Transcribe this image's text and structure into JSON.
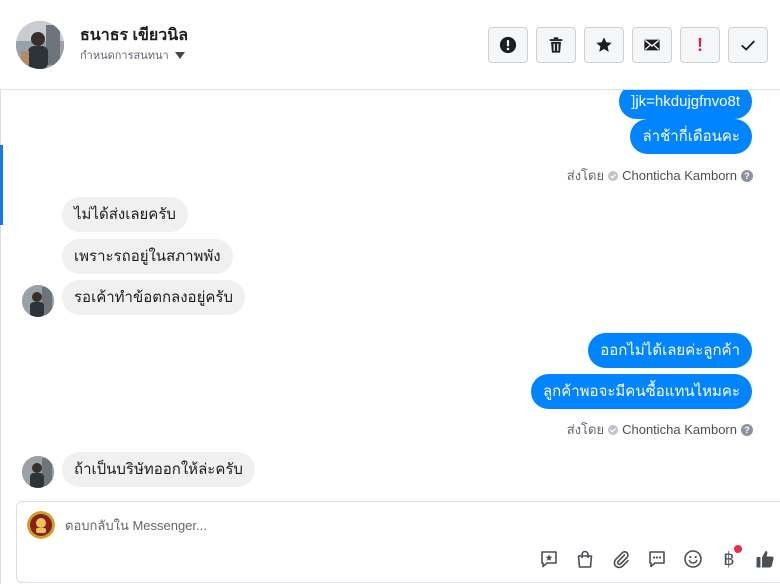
{
  "header": {
    "contact_name": "ธนาธร เขียวนิล",
    "status_label": "กำหนดการสนทนา"
  },
  "actions": [
    {
      "name": "report-button",
      "icon": "exclamation-circle-icon"
    },
    {
      "name": "delete-button",
      "icon": "trash-icon"
    },
    {
      "name": "star-button",
      "icon": "star-icon"
    },
    {
      "name": "mark-unread-button",
      "icon": "envelope-icon"
    },
    {
      "name": "mark-important-button",
      "icon": "exclamation-icon",
      "label": "!"
    },
    {
      "name": "mark-done-button",
      "icon": "checkmark-icon"
    }
  ],
  "messages": [
    {
      "dir": "out",
      "text": "]jk=hkdujgfnvo8t"
    },
    {
      "dir": "out",
      "text": "ล่าช้ากี่เดือนคะ"
    },
    {
      "type": "sent_by",
      "prefix": "ส่งโดย",
      "sender": "Chonticha Kamborn"
    },
    {
      "dir": "in",
      "text": "ไม่ได้ส่งเลยครับ"
    },
    {
      "dir": "in",
      "text": "เพราะรถอยู่ในสภาพพัง"
    },
    {
      "dir": "in",
      "text": "รอเค้าทำข้อตกลงอยู่ครับ"
    },
    {
      "dir": "out",
      "text": "ออกไม่ได้เลยค่ะลูกค้า"
    },
    {
      "dir": "out",
      "text": "ลูกค้าพอจะมีคนซื้อแทนไหมคะ"
    },
    {
      "type": "sent_by",
      "prefix": "ส่งโดย",
      "sender": "Chonticha Kamborn"
    },
    {
      "dir": "in",
      "text": "ถ้าเป็นบริษัทออกให้ล่ะครับ"
    }
  ],
  "composer": {
    "placeholder": "ตอบกลับใน Messenger...",
    "tools": [
      "saved-reply-icon",
      "shopping-bag-icon",
      "attachment-icon",
      "chat-bubble-icon",
      "emoji-icon",
      "baht-payment-icon",
      "like-icon"
    ],
    "baht_symbol": "฿"
  },
  "colors": {
    "accent": "#1877f2",
    "outgoing_bubble": "#0084ff",
    "incoming_bubble": "#f1f0f0",
    "important": "#e41e3f",
    "notification_dot": "#f02849"
  }
}
